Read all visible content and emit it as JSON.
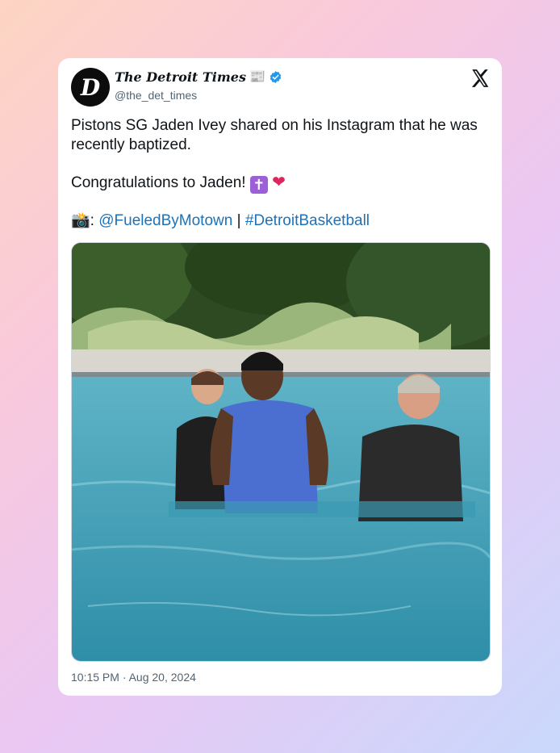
{
  "tweet": {
    "display_name": "The Detroit Times",
    "avatar_letter": "D",
    "handle": "@the_det_times",
    "body_line1": "Pistons SG Jaden Ivey shared on his Instagram that he was recently baptized.",
    "body_line2_text": "Congratulations to Jaden!",
    "cross_emoji": "✝",
    "heart_emoji": "❤",
    "camera_emoji": "📸",
    "credit_sep": ":",
    "credit_handle": "@FueledByMotown",
    "credit_divider": "|",
    "credit_hashtag": "#DetroitBasketball",
    "timestamp": "10:15 PM · Aug 20, 2024"
  },
  "icons": {
    "news": "newspaper-icon",
    "verified": "verified-badge-icon",
    "platform": "x-logo-icon"
  },
  "colors": {
    "link": "#1d72b8",
    "verified": "#1d9bf0",
    "text": "#0f1419",
    "muted": "#536471"
  }
}
